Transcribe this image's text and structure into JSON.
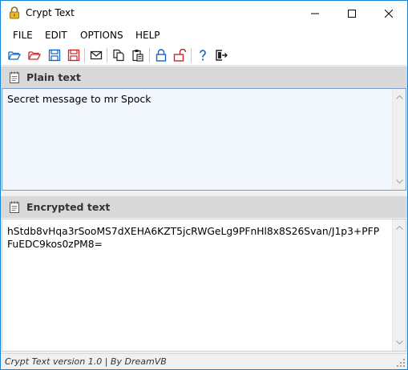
{
  "window": {
    "title": "Crypt Text"
  },
  "menu": [
    "FILE",
    "EDIT",
    "OPTIONS",
    "HELP"
  ],
  "toolbar": {
    "icons": [
      "open-folder-icon",
      "open-red-folder-icon",
      "save-icon",
      "save-red-icon",
      "envelope-icon",
      "copy-icon",
      "paste-icon",
      "lock-icon",
      "unlock-icon",
      "help-icon",
      "exit-icon"
    ]
  },
  "plain": {
    "header": "Plain text",
    "text": "Secret message to mr Spock"
  },
  "encrypted": {
    "header": "Encrypted text",
    "text": "hStdb8vHqa3rSooMS7dXEHA6KZT5jcRWGeLg9PFnHl8x8S26Svan/J1p3+PFP\nFuEDC9kos0zPM8="
  },
  "status": {
    "text": "Crypt Text version 1.0 | By DreamVB"
  },
  "colors": {
    "accent": "#1883d7",
    "header_bg": "#d9d9d9",
    "plain_bg": "#f2f7fd"
  }
}
